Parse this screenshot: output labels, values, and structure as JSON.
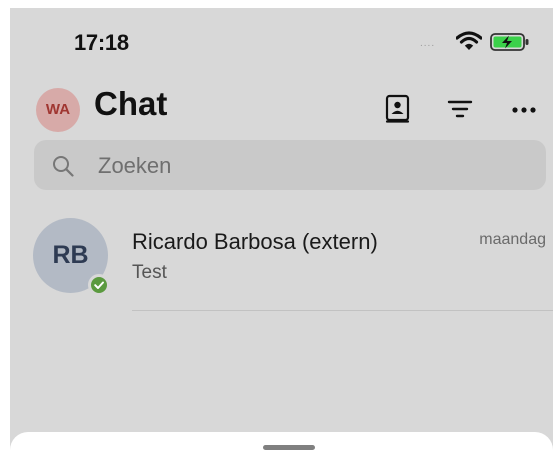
{
  "status_bar": {
    "time": "17:18",
    "signal": "....",
    "wifi_icon": "wifi-icon",
    "battery_icon": "battery-charging-icon",
    "battery_color": "#3bd14a"
  },
  "header": {
    "avatar_initials": "WA",
    "title": "Chat",
    "actions": [
      "contacts-book-icon",
      "filter-icon",
      "more-icon"
    ]
  },
  "search": {
    "placeholder": "Zoeken",
    "icon": "search-icon"
  },
  "chats": [
    {
      "initials": "RB",
      "name": "Ricardo Barbosa (extern)",
      "time": "maandag",
      "preview": "Test",
      "presence": "available",
      "presence_color": "#5b9a3f"
    }
  ],
  "colors": {
    "overlay_background": "#d8d8d8",
    "avatar_me_bg": "#d7aaa8",
    "avatar_me_text": "#a03631",
    "chat_avatar_bg": "#b3bac5",
    "chat_avatar_text": "#2e3b53"
  }
}
